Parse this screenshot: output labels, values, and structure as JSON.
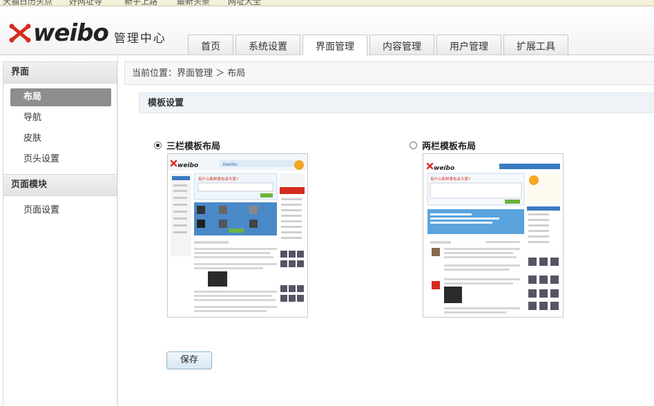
{
  "bookmarks": [
    "天猫日历头点",
    "好网址导",
    "新手上路",
    "最新头条",
    "网址大全"
  ],
  "logo": {
    "brand": "weibo",
    "subtitle": "管理中心",
    "brand_color": "#d52b1e"
  },
  "tabs": [
    {
      "label": "首页"
    },
    {
      "label": "系统设置"
    },
    {
      "label": "界面管理",
      "active": true
    },
    {
      "label": "内容管理"
    },
    {
      "label": "用户管理"
    },
    {
      "label": "扩展工具"
    }
  ],
  "sidebar": {
    "groups": [
      {
        "title": "界面",
        "items": [
          {
            "label": "布局",
            "active": true
          },
          {
            "label": "导航"
          },
          {
            "label": "皮肤"
          },
          {
            "label": "页头设置"
          }
        ]
      },
      {
        "title": "页面模块",
        "items": [
          {
            "label": "页面设置"
          }
        ]
      }
    ]
  },
  "breadcrumb": {
    "text": "当前位置：界面管理 ＞ 布局"
  },
  "section": {
    "title": "模板设置"
  },
  "options": [
    {
      "label": "三栏模板布局",
      "checked": true
    },
    {
      "label": "两栏模板布局",
      "checked": false
    }
  ],
  "thumbs": [
    {
      "brand": "weibo",
      "slogan": "Xweibo",
      "note": "有什么新鲜事告诉大家?",
      "publish": "发布"
    },
    {
      "brand": "weibo",
      "slogan": "",
      "note": "有什么新鲜事告诉大家?",
      "publish": "发布"
    }
  ],
  "save_label": "保存"
}
